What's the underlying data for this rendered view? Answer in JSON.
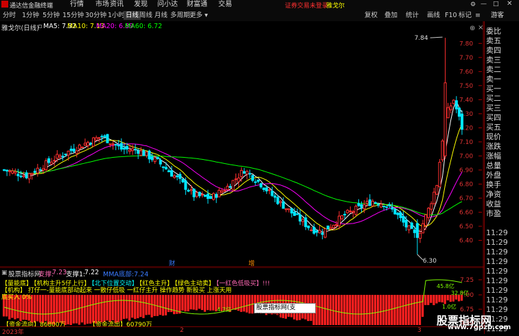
{
  "app": {
    "title": "通达信金融终端",
    "menu": [
      "行情",
      "市场",
      "资讯",
      "发现",
      "问小达",
      "财富通",
      "交易"
    ],
    "notice": "证券交易未登录",
    "stock_name_top": "雅戈尔",
    "right_icons": [
      "gear-icon",
      "minimize-icon",
      "maximize-icon",
      "close-icon"
    ]
  },
  "toolbar": {
    "timeframes": [
      "分时",
      "1分钟",
      "5分钟",
      "15分钟",
      "30分钟",
      "1小时",
      "日线",
      "周线",
      "月线",
      "多周期",
      "更多"
    ],
    "active": "日线",
    "right_buttons": [
      "复权",
      "叠加",
      "统计",
      "画线",
      "F10",
      "标记",
      "≡"
    ]
  },
  "main_chart": {
    "header_title": "雅戈尔(日线)",
    "ma": [
      {
        "label": "MA5: 7.32",
        "color": "#ffffff"
      },
      {
        "label": "MA10: 7.13",
        "color": "#ffff00"
      },
      {
        "label": "MA20: 6.89",
        "color": "#ff00ff"
      },
      {
        "label": "MA60: 6.72",
        "color": "#00ff00"
      }
    ],
    "y_ticks": [
      "7.80",
      "7.70",
      "7.60",
      "7.50",
      "7.40",
      "7.30",
      "7.20",
      "7.10",
      "7.00",
      "6.90",
      "6.80",
      "6.70",
      "6.60",
      "6.50",
      "6.40"
    ],
    "high_label": "7.84",
    "low_label": "6.30",
    "markers": [
      {
        "text": "财",
        "color": "#3a7bff"
      },
      {
        "text": "增",
        "color": "#ff8c00"
      }
    ],
    "date_labels": [
      "2023年",
      "2",
      "3"
    ]
  },
  "sub_chart": {
    "title": "股票指标网",
    "support_label": "支撑:",
    "support_value": "7.23",
    "support2_label": "支撑1:",
    "support2_value": "7.22",
    "extra": "MMA底部:7.24",
    "line1": [
      {
        "text": "【量能底】",
        "color": "#ffff00"
      },
      {
        "text": "【机构主升5仔上行】",
        "color": "#ffff00"
      },
      {
        "text": "【北下位置交动】",
        "color": "#00ffff"
      },
      {
        "text": "【红色主升】",
        "color": "#ffff00"
      },
      {
        "text": "【绿色主动卖】",
        "color": "#ffff00"
      },
      {
        "text": "【一红色低吸买】!!!",
        "color": "#ff69b4"
      }
    ],
    "line2": "【机构】 打仔一-量能底部动起来 一散仔低吸 一红仔主升 操作趋势 新股买 上涨天用",
    "line3": "底买入 0%",
    "y_ticks": [
      "7.25",
      "7.00",
      "6.75",
      "6.50"
    ],
    "bottom_labels": [
      {
        "text": "【资金流向】86800万",
        "color": "#ffff00"
      },
      {
        "text": "【资金流出】60790万",
        "color": "#ffff00"
      }
    ],
    "tooltip": "股票指标网(支撑):7.23",
    "small_labels": [
      "45.8亿",
      "32.8亿",
      "4.7亿",
      "1.0亿"
    ]
  },
  "right_panel": {
    "labels": [
      "委比",
      "卖五",
      "卖四",
      "卖三",
      "卖二",
      "卖一",
      "买一",
      "买二",
      "买三",
      "买四",
      "买五",
      "现价",
      "涨跌",
      "涨幅",
      "总量",
      "外盘",
      "换手",
      "净资",
      "收益",
      "市盈",
      "",
      "11:29",
      "11:29",
      "11:29",
      "11:29",
      "11:29",
      "11:29",
      "11:29",
      "11:29",
      "11:29",
      "11:29",
      "11:29"
    ],
    "top_buttons": [
      "游客"
    ]
  },
  "watermark": {
    "site": "股票指标网",
    "url": "www.7gpzb.com"
  },
  "colors": {
    "up": "#ff3030",
    "down": "#00e5ff",
    "ma5": "#ffffff",
    "ma10": "#ffff00",
    "ma20": "#ff00ff",
    "ma60": "#00ff00",
    "accent_red": "#7a0000"
  }
}
